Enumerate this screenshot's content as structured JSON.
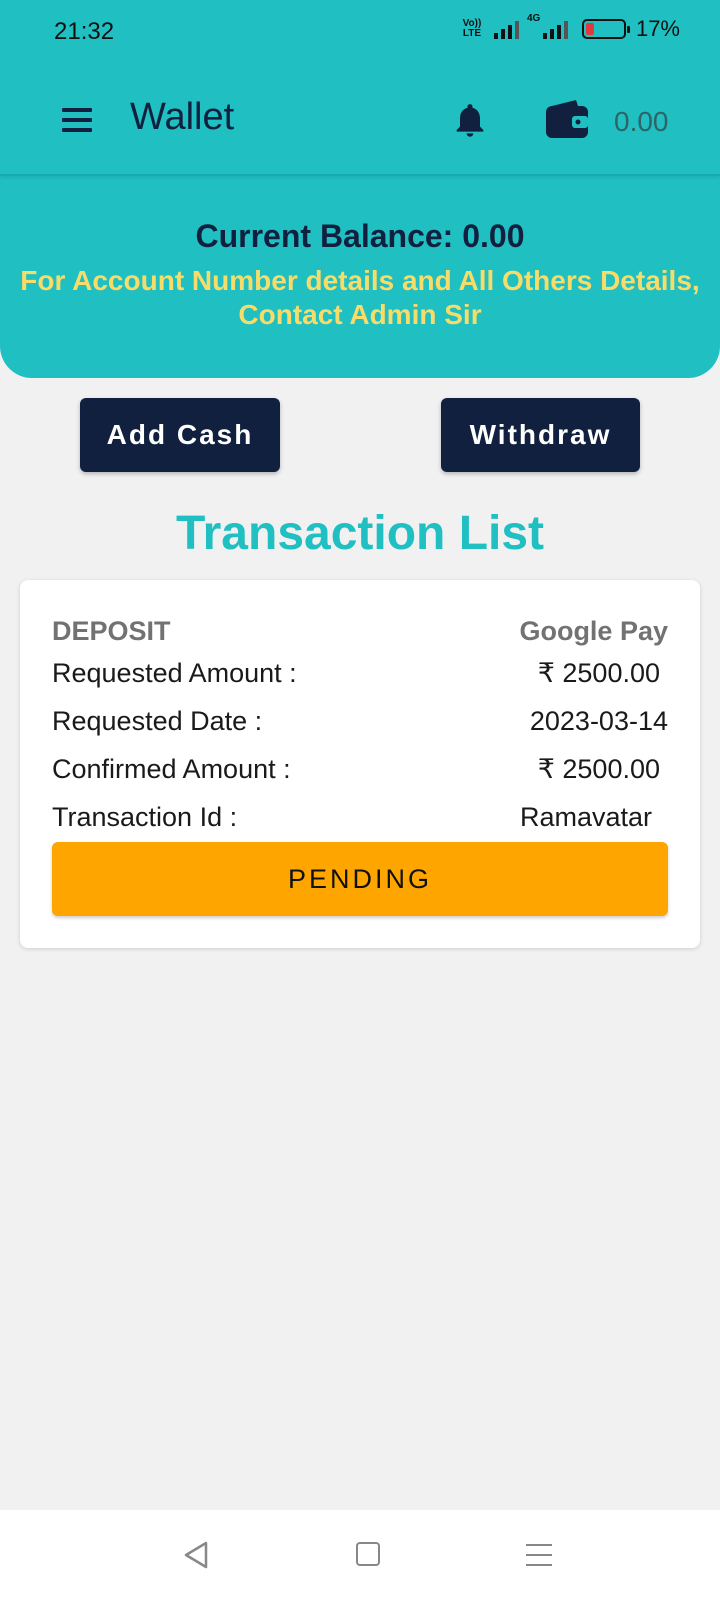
{
  "status_bar": {
    "time": "21:32",
    "volte_top": "Vo))",
    "volte_bottom": "LTE",
    "network": "4G",
    "battery_percent": "17%"
  },
  "app_bar": {
    "title": "Wallet",
    "wallet_amount": "0.00",
    "icons": [
      "menu-icon",
      "bell-icon",
      "wallet-icon"
    ]
  },
  "balance": {
    "text": "Current Balance: 0.00",
    "notice": "For Account Number details and All Others Details, Contact Admin Sir"
  },
  "actions": {
    "add_cash": "Add Cash",
    "withdraw": "Withdraw"
  },
  "transactions": {
    "title": "Transaction List",
    "items": [
      {
        "type": "DEPOSIT",
        "method": "Google Pay",
        "rows": [
          {
            "label": "Requested Amount :",
            "value": "₹ 2500.00"
          },
          {
            "label": "Requested Date :",
            "value": "2023-03-14"
          },
          {
            "label": "Confirmed Amount :",
            "value": "₹ 2500.00"
          },
          {
            "label": "Transaction Id :",
            "value": "Ramavatar"
          }
        ],
        "status": "PENDING"
      }
    ]
  },
  "colors": {
    "primary": "#1fbfc2",
    "dark": "#10203e",
    "notice": "#f7dc6a",
    "pending": "#ffa500",
    "background": "#f1f1f2"
  },
  "nav_bar": {
    "icons": [
      "back-icon",
      "home-icon",
      "recents-icon"
    ]
  }
}
